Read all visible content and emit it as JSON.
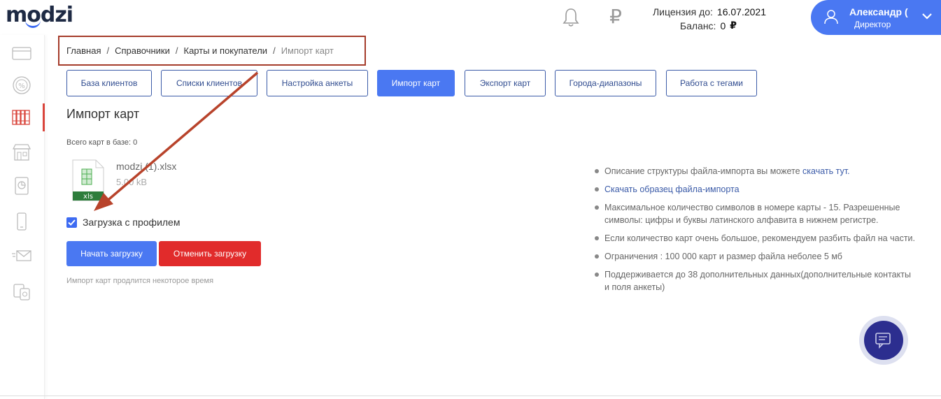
{
  "header": {
    "logo": "modzi",
    "license_label": "Лицензия до:",
    "license_value": "16.07.2021",
    "balance_label": "Баланс:",
    "balance_value": "0",
    "currency": "₽",
    "user_name": "Александр (",
    "user_role": "Директор"
  },
  "sidebar": {
    "items": [
      "card-icon",
      "percent-icon",
      "books-icon",
      "store-icon",
      "report-icon",
      "phone-icon",
      "mail-icon",
      "devices-icon"
    ],
    "active_index": 2
  },
  "breadcrumb": {
    "items": [
      "Главная",
      "Справочники",
      "Карты и покупатели"
    ],
    "current": "Импорт карт"
  },
  "tabs": [
    {
      "label": "База клиентов",
      "active": false
    },
    {
      "label": "Списки клиентов",
      "active": false
    },
    {
      "label": "Настройка анкеты",
      "active": false
    },
    {
      "label": "Импорт карт",
      "active": true
    },
    {
      "label": "Экспорт карт",
      "active": false
    },
    {
      "label": "Города-диапазоны",
      "active": false
    },
    {
      "label": "Работа с тегами",
      "active": false
    }
  ],
  "main": {
    "title": "Импорт карт",
    "total_label": "Всего карт в базе: 0",
    "file": {
      "name": "modzi (1).xlsx",
      "size": "5.00 kB",
      "ext_label": "xls"
    },
    "checkbox_label": "Загрузка с профилем",
    "checkbox_checked": true,
    "start_button": "Начать загрузку",
    "cancel_button": "Отменить загрузку",
    "note": "Импорт карт продлится некоторое время"
  },
  "info": {
    "item1_text": "Описание структуры файла-импорта вы можете ",
    "item1_link": "скачать тут.",
    "item2_link": "Скачать образец файла-импорта",
    "item3": "Максимальное количество символов в номере карты - 15. Разрешенные символы: цифры и буквы латинского алфавита в нижнем регистре.",
    "item4": "Если количество карт очень большое, рекомендуем разбить файл на части.",
    "item5": "Ограничения : 100 000 карт и размер файла неболее 5 мб",
    "item6": "Поддерживается до 38 дополнительных данных(дополнительные контакты и поля анкеты)"
  },
  "colors": {
    "accent": "#4a78f2",
    "danger": "#e12b2b",
    "annotation": "#a53b2a",
    "chat": "#2c2e8f"
  }
}
